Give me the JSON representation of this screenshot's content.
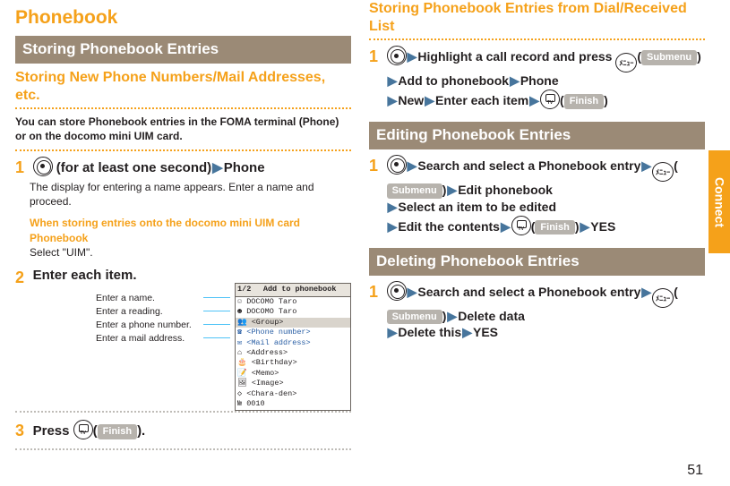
{
  "left": {
    "title": "Phonebook",
    "h2": "Storing Phonebook Entries",
    "h3": "Storing New Phone Numbers/Mail Addresses, etc.",
    "intro": "You can store Phonebook entries in the FOMA terminal (Phone) or on the docomo mini UIM card.",
    "step1": {
      "part1": " (for at least one second)",
      "target": "Phone",
      "note": "The display for entering a name appears. Enter a name and proceed.",
      "subtitle": "When storing entries onto the docomo mini UIM card Phonebook",
      "subtext": "Select \"UIM\"."
    },
    "step2": "Enter each item.",
    "annot": {
      "a": "Enter a name.",
      "b": "Enter a reading.",
      "c": "Enter a phone number.",
      "d": "Enter a mail address."
    },
    "mock": {
      "title": "Add to phonebook",
      "r1": "DOCOMO Taro",
      "r2": "DOCOMO Taro",
      "r3": "<Group>",
      "r4": "<Phone number>",
      "r5": "<Mail address>",
      "r6": "<Address>",
      "r7": "<Birthday>",
      "r8": "<Memo>",
      "r9": "<Image>",
      "r10": "<Chara-den>",
      "r11": "0010"
    },
    "step3a": "Press ",
    "step3b": "(",
    "step3btn": "Finish",
    "step3c": ")."
  },
  "right": {
    "h3a": "Storing Phonebook Entries from Dial/Received List",
    "s1": {
      "a": "Highlight a call record and press ",
      "b": "(",
      "submenu": "Submenu",
      "c": ")",
      "d": "Add to phonebook",
      "e": "Phone",
      "f": "New",
      "g": "Enter each item",
      "h": "(",
      "finish": "Finish",
      "i": ")"
    },
    "h2b": "Editing Phonebook Entries",
    "s2": {
      "a": "Search and select a Phonebook entry",
      "b": "(",
      "submenu": "Submenu",
      "c": ")",
      "d": "Edit phonebook",
      "e": "Select an item to be edited",
      "f": "Edit the contents",
      "g": "(",
      "finish": "Finish",
      "h": ")",
      "i": "YES"
    },
    "h2c": "Deleting Phonebook Entries",
    "s3": {
      "a": "Search and select a Phonebook entry",
      "b": "(",
      "submenu": "Submenu",
      "c": ")",
      "d": "Delete data",
      "e": "Delete this",
      "f": "YES"
    }
  },
  "menu_jp": "ﾒﾆｭｰ",
  "sidetab": "Connect",
  "pagenum": "51"
}
